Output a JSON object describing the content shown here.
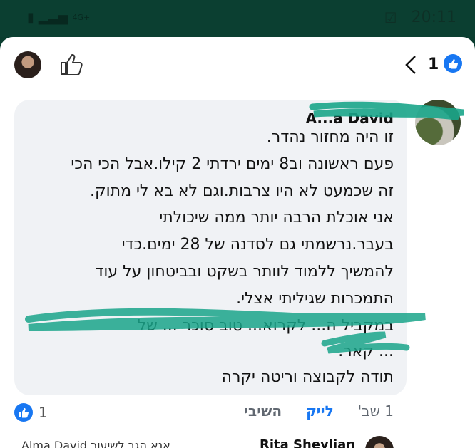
{
  "status_bar": {
    "time": "20:11",
    "network": "4G+"
  },
  "header": {
    "reaction_count": "1"
  },
  "comment": {
    "author": "A...a David",
    "lines": [
      "זו היה מחזור נהדר.",
      "פעם ראשונה וב8 ימים ירדתי 2 קילו.אבל הכי הכי",
      "זה שכמעט לא היו צרבות.וגם לא בא לי מתוק.",
      "אני אוכלת הרבה יותר ממה שיכולתי",
      "בעבר.נרשמתי גם לסדנה של 28 ימים.כדי",
      "להמשיך ללמוד לוותר בשקט ובביטחון על עוד",
      "התמכרות שגיליתי אצלי.",
      "במקביל ה... לקרוא... טוב סוכר ... של",
      "... קאר.",
      "תודה לקבוצה וריטה יקרה"
    ],
    "reaction_count": "1",
    "time": "1 שב'",
    "like_label": "לייק",
    "reply_label": "השיבי"
  },
  "next_comment": {
    "author": "Rita Sheylian",
    "snippet": "Alma David  אנא הגב לשיעור ... "
  },
  "colors": {
    "accent": "#1877f2",
    "status_bg": "#0b3f31",
    "bubble_bg": "#f0f2f5",
    "scribble": "#1aa58a"
  }
}
